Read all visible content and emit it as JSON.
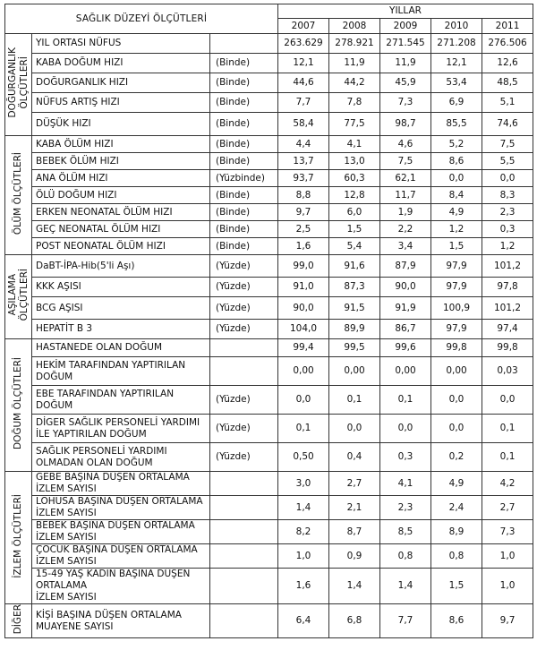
{
  "header": {
    "title": "SAĞLIK DÜZEYİ ÖLÇÜTLERİ",
    "years_label": "YILLAR",
    "years": [
      "2007",
      "2008",
      "2009",
      "2010",
      "2011"
    ]
  },
  "groups": [
    {
      "label": "DOĞURGANLIK\nÖLÇÜTLERİ",
      "rows": [
        {
          "label": "YIL ORTASI NÜFUS",
          "unit": "",
          "values": [
            "263.629",
            "278.921",
            "271.545",
            "271.208",
            "276.506"
          ],
          "h": 22
        },
        {
          "label": "KABA DOĞUM HIZI",
          "unit": "(Binde)",
          "values": [
            "12,1",
            "11,9",
            "11,9",
            "12,1",
            "12,6"
          ],
          "h": 22
        },
        {
          "label": "DOĞURGANLIK HIZI",
          "unit": "(Binde)",
          "values": [
            "44,6",
            "44,2",
            "45,9",
            "53,4",
            "48,5"
          ],
          "h": 22
        },
        {
          "label": "NÜFUS ARTIŞ HIZI",
          "unit": "(Binde)",
          "values": [
            "7,7",
            "7,8",
            "7,3",
            "6,9",
            "5,1"
          ],
          "h": 22
        },
        {
          "label": "DÜŞÜK HIZI",
          "unit": "(Binde)",
          "values": [
            "58,4",
            "77,5",
            "98,7",
            "85,5",
            "74,6"
          ],
          "h": 26
        }
      ]
    },
    {
      "label": "ÖLÜM ÖLÇÜTLERİ",
      "rows": [
        {
          "label": "KABA ÖLÜM HIZI",
          "unit": "(Binde)",
          "values": [
            "4,4",
            "4,1",
            "4,6",
            "5,2",
            "7,5"
          ],
          "h": 19
        },
        {
          "label": "BEBEK ÖLÜM HIZI",
          "unit": "(Binde)",
          "values": [
            "13,7",
            "13,0",
            "7,5",
            "8,6",
            "5,5"
          ],
          "h": 19
        },
        {
          "label": "ANA ÖLÜM HIZI",
          "unit": "(Yüzbinde)",
          "values": [
            "93,7",
            "60,3",
            "62,1",
            "0,0",
            "0,0"
          ],
          "h": 19
        },
        {
          "label": "ÖLÜ DOĞUM HIZI",
          "unit": "(Binde)",
          "values": [
            "8,8",
            "12,8",
            "11,7",
            "8,4",
            "8,3"
          ],
          "h": 19
        },
        {
          "label": "ERKEN NEONATAL ÖLÜM HIZI",
          "unit": "(Binde)",
          "values": [
            "9,7",
            "6,0",
            "1,9",
            "4,9",
            "2,3"
          ],
          "h": 19
        },
        {
          "label": "GEÇ NEONATAL ÖLÜM HIZI",
          "unit": "(Binde)",
          "values": [
            "2,5",
            "1,5",
            "2,2",
            "1,2",
            "0,3"
          ],
          "h": 19
        },
        {
          "label": "POST NEONATAL ÖLÜM HIZI",
          "unit": "(Binde)",
          "values": [
            "1,6",
            "5,4",
            "3,4",
            "1,5",
            "1,2"
          ],
          "h": 19
        }
      ]
    },
    {
      "label": "AŞILAMA\nÖLÇÜTLERİ",
      "rows": [
        {
          "label": "DaBT-İPA-Hib(5'li Aşı)",
          "unit": "(Yüzde)",
          "values": [
            "99,0",
            "91,6",
            "87,9",
            "97,9",
            "101,2"
          ],
          "h": 25
        },
        {
          "label": "KKK AŞISI",
          "unit": "(Yüzde)",
          "values": [
            "91,0",
            "87,3",
            "90,0",
            "97,9",
            "97,8"
          ],
          "h": 22
        },
        {
          "label": "BCG AŞISI",
          "unit": "(Yüzde)",
          "values": [
            "90,0",
            "91,5",
            "91,9",
            "100,9",
            "101,2"
          ],
          "h": 25
        },
        {
          "label": "HEPATİT B 3",
          "unit": "(Yüzde)",
          "values": [
            "104,0",
            "89,9",
            "86,7",
            "97,9",
            "97,4"
          ],
          "h": 22
        }
      ]
    },
    {
      "label": "DOĞUM ÖLÇÜTLERİ",
      "rows": [
        {
          "label": "HASTANEDE OLAN DOĞUM",
          "unit": "",
          "values": [
            "99,4",
            "99,5",
            "99,6",
            "99,8",
            "99,8"
          ],
          "h": 20
        },
        {
          "label": "HEKİM TARAFINDAN YAPTIRILAN|DOĞUM",
          "unit": "",
          "values": [
            "0,00",
            "0,00",
            "0,00",
            "0,00",
            "0,03"
          ],
          "h": 32
        },
        {
          "label": "EBE TARAFINDAN YAPTIRILAN|DOĞUM",
          "unit": "(Yüzde)",
          "values": [
            "0,0",
            "0,1",
            "0,1",
            "0,0",
            "0,0"
          ],
          "h": 32
        },
        {
          "label": "DİGER SAĞLIK PERSONELİ YARDIMI|İLE YAPTIRILAN DOĞUM",
          "unit": "(Yüzde)",
          "values": [
            "0,1",
            "0,0",
            "0,0",
            "0,0",
            "0,1"
          ],
          "h": 32
        },
        {
          "label": "SAĞLIK PERSONELİ YARDIMI|OLMADAN OLAN DOĞUM",
          "unit": "(Yüzde)",
          "values": [
            "0,50",
            "0,4",
            "0,3",
            "0,2",
            "0,1"
          ],
          "h": 32
        }
      ]
    },
    {
      "label": "İZLEM ÖLÇÜTLERİ",
      "rows": [
        {
          "label": "GEBE BAŞINA DÜŞEN ORTALAMA İZLEM SAYISI",
          "unit": "",
          "values": [
            "3,0",
            "2,7",
            "4,1",
            "4,9",
            "4,2"
          ],
          "h": 24
        },
        {
          "label": "LOHUSA BAŞINA DÜŞEN ORTALAMA İZLEM SAYISI",
          "unit": "",
          "values": [
            "1,4",
            "2,1",
            "2,3",
            "2,4",
            "2,7"
          ],
          "h": 24
        },
        {
          "label": "BEBEK BAŞINA DÜŞEN ORTALAMA İZLEM SAYISI",
          "unit": "",
          "values": [
            "8,2",
            "8,7",
            "8,5",
            "8,9",
            "7,3"
          ],
          "h": 26
        },
        {
          "label": "ÇOCUK BAŞINA DÜŞEN ORTALAMA İZLEM SAYISI",
          "unit": "",
          "values": [
            "1,0",
            "0,9",
            "0,8",
            "0,8",
            "1,0"
          ],
          "h": 22
        },
        {
          "label": "15-49 YAŞ KADIN BAŞINA DÜŞEN ORTALAMA|İZLEM SAYISI",
          "unit": "",
          "values": [
            "1,6",
            "1,4",
            "1,4",
            "1,5",
            "1,0"
          ],
          "h": 34
        }
      ]
    },
    {
      "label": "DİĞER",
      "rows": [
        {
          "label": "KİŞİ BAŞINA DÜŞEN ORTALAMA|MUAYENE SAYISI",
          "unit": "",
          "values": [
            "6,4",
            "6,8",
            "7,7",
            "8,6",
            "9,7"
          ],
          "h": 36
        }
      ]
    }
  ]
}
